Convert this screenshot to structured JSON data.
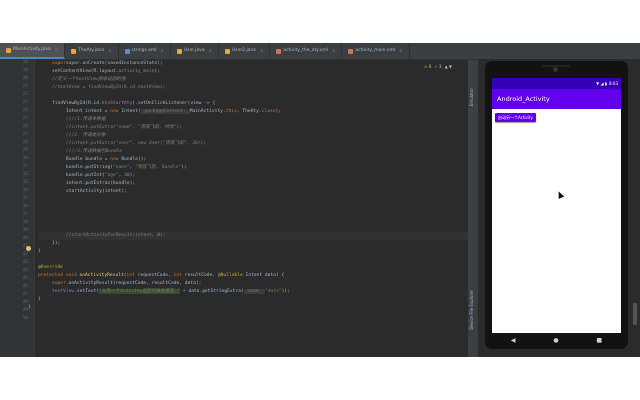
{
  "tabs": [
    {
      "label": "MainActivity.java",
      "active": true
    },
    {
      "label": "TheAty.java",
      "active": false
    },
    {
      "label": "strings.xml",
      "active": false
    },
    {
      "label": "User.java",
      "active": false
    },
    {
      "label": "User2.java",
      "active": false
    },
    {
      "label": "activity_the_aty.xml",
      "active": false
    },
    {
      "label": "activity_main.xml",
      "active": false
    }
  ],
  "warnings": {
    "count": "⚠ 6",
    "ok": "✓ 3",
    "arrows": "▲ ▼"
  },
  "line_numbers": [
    "18",
    "19",
    "20",
    "21",
    "22",
    "23",
    "24",
    "25",
    "26",
    "27",
    "28",
    "29",
    "30",
    "31",
    "32",
    "33",
    "34",
    "35",
    "36",
    "37",
    "38",
    "39",
    "40",
    "41",
    "42",
    "43",
    "44",
    "45",
    "46",
    "47",
    "48",
    "49",
    "50"
  ],
  "code": {
    "l0": "super.onCreate(savedInstanceState);",
    "l1a": "setContentView(R.layout.",
    "l1b": "activity_main",
    "l1c": ");",
    "l2": "//定义一个textView接收返回的值",
    "l3": "//textView = findViewById(R.id.textView);",
    "l5a": "findViewById(R.id.",
    "l5b": "btnStartAty",
    "l5c": ").setOnClickListener(view -> {",
    "l6a": "Intent intent = ",
    "l6b": "new",
    "l6c": " Intent(",
    "l6d": " packageContext: ",
    "l6e": "MainActivity.",
    "l6f": "this",
    "l6g": ", TheAty.",
    "l6h": "class",
    "l6i": ");",
    "l7": "////1.传递单数据",
    "l8": "//intent.putExtra(\"name\", \"雨夜飞影, 哈哈\");",
    "l9": "///2. 传递类对象",
    "l10": "//intent.putExtra(\"user\", new User(\"雨夜飞影\", 30));",
    "l11": "////3.传递数据包Bundle",
    "l12a": "Bundle bundle = ",
    "l12b": "new",
    "l12c": " Bundle();",
    "l13a": "bundle.putString(",
    "l13b": "\"name\"",
    "l13c": ", ",
    "l13d": "\"雨夜飞影, Bundle\"",
    "l13e": ");",
    "l14a": "bundle.putInt(",
    "l14b": "\"age\"",
    "l14c": ", ",
    "l14d": "30",
    "l14e": ");",
    "l15": "intent.putExtras(bundle);",
    "l16": "startActivity(intent);",
    "l18a": "//startActivityForResult(intent, ",
    "l18b": "0",
    "l18c": ");",
    "l19": "});",
    "l20": "}",
    "l22": "@Override",
    "l23a": "protected void ",
    "l23b": "onActivityResult",
    "l23c": "(",
    "l23d": "int",
    "l23e": " requestCode, ",
    "l23f": "int",
    "l23g": " resultCode, ",
    "l23h": "@Nullable",
    "l23i": " Intent data) {",
    "l24a": "super",
    "l24b": ".onActivityResult(requestCode, resultCode, data);",
    "l25a": "textView",
    "l25b": ".setText(",
    "l25c": "\"从另一个Activity返回的数据值是:\"",
    "l25d": " + data.getStringExtra(",
    "l25e": " name: ",
    "l25f": "\"data\"",
    "l25g": "));",
    "l26": "}",
    "l27": "}"
  },
  "side_tabs": [
    "Emulator",
    "Device File Explorer",
    "Gradle"
  ],
  "emulator": {
    "status_time": "8:03",
    "status_icons": "▼ ◢ ▮",
    "app_title": "Android_Activity",
    "button_label": "启动另一个Activity",
    "nav_back": "◀",
    "nav_home": "●",
    "nav_recent": "■"
  }
}
